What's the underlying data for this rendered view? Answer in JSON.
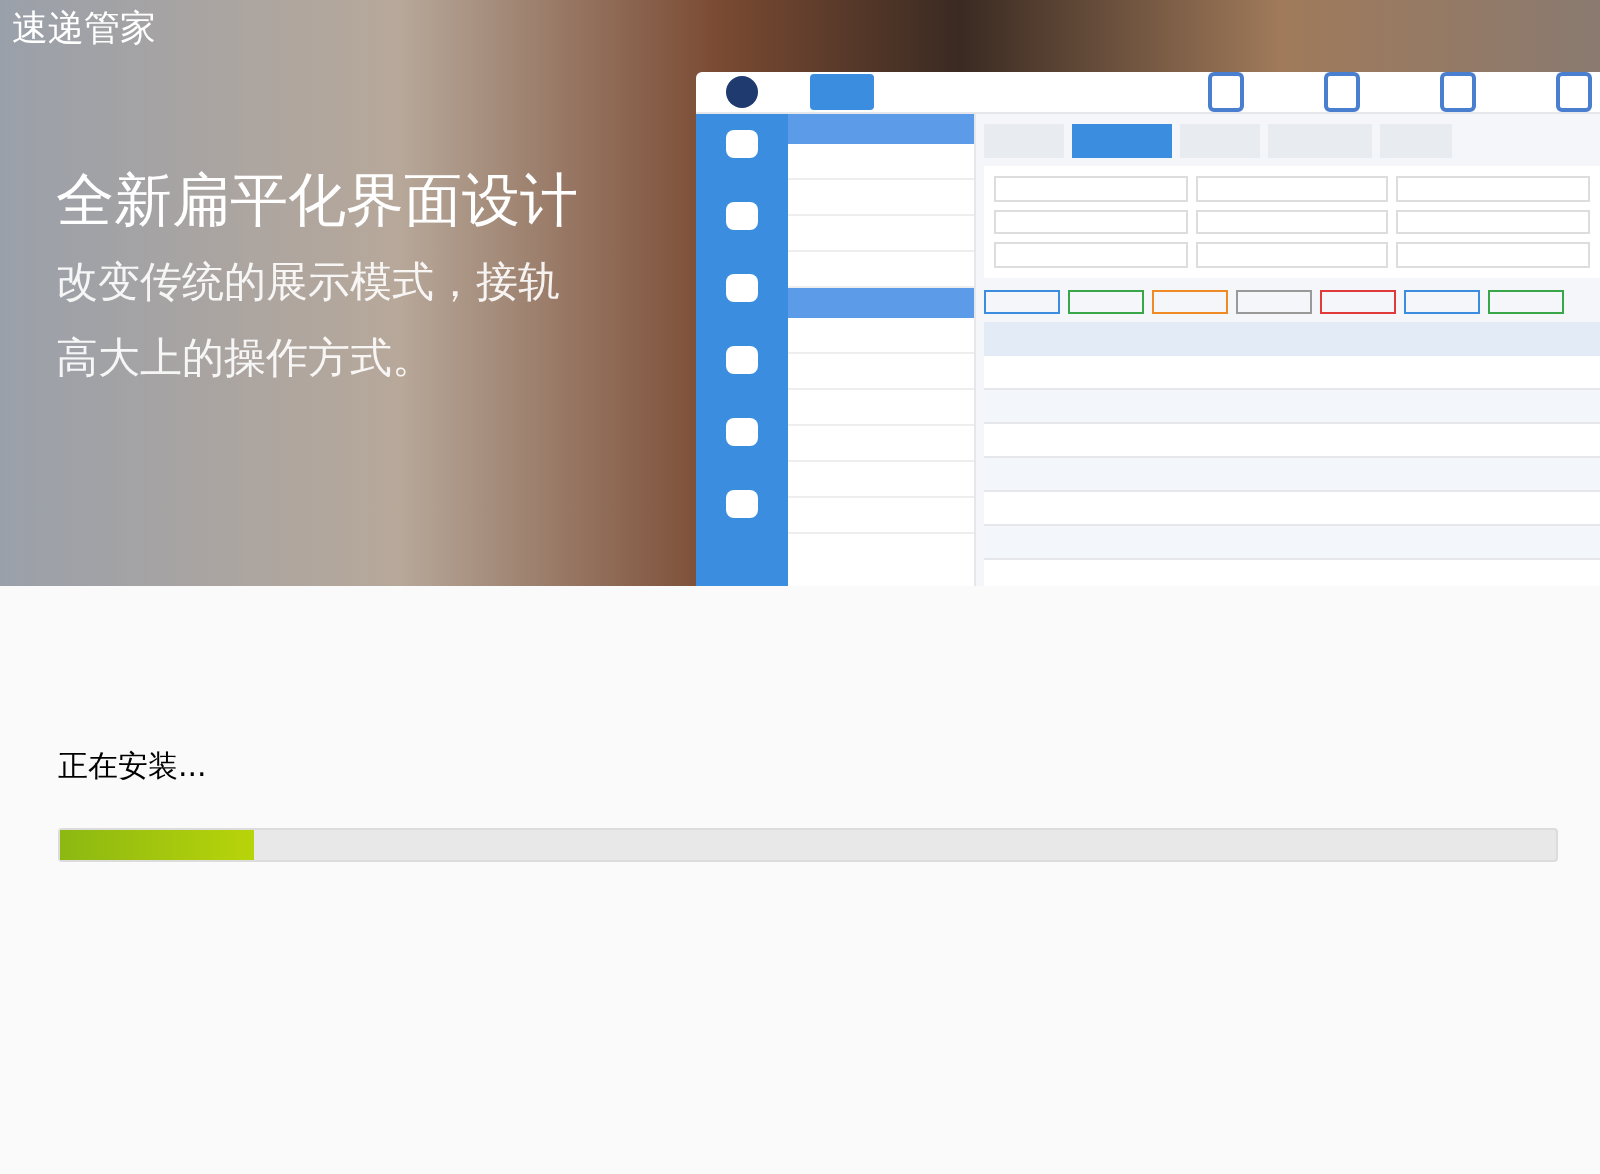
{
  "window": {
    "title": "速递管家"
  },
  "banner": {
    "headline": "全新扁平化界面设计",
    "lines": [
      "改变传统的展示模式，接轨",
      "高大上的操作方式。"
    ]
  },
  "install": {
    "status": "正在安装...",
    "level": 0.13
  }
}
